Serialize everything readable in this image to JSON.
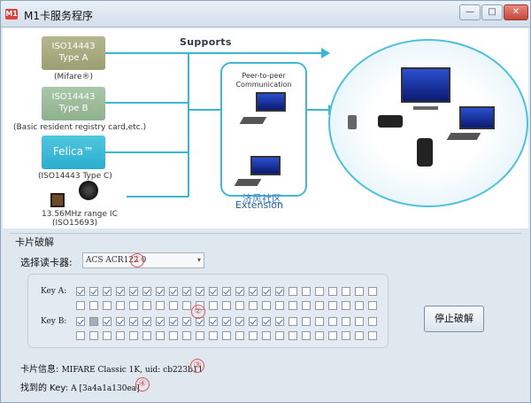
{
  "window": {
    "title": "M1卡服务程序",
    "logo_text": "M1",
    "min_glyph": "—",
    "max_glyph": "□",
    "close_glyph": "✕"
  },
  "banner": {
    "supports": "Supports",
    "card_a_line1": "ISO14443",
    "card_a_line2": "Type A",
    "card_a_caption": "(Mifare®)",
    "card_b_line1": "ISO14443",
    "card_b_line2": "Type B",
    "card_b_caption": "(Basic resident registry card,etc.)",
    "card_felica": "Felica™",
    "card_felica_caption": "(ISO14443 Type C)",
    "ic_caption_line1": "13.56MHz range IC",
    "ic_caption_line2": "(ISO15693)",
    "p2p_line1": "Peer-to-peer",
    "p2p_line2": "Communication",
    "extension": "Extension",
    "watermark": "济风社区"
  },
  "group": {
    "title": "卡片破解",
    "reader_label": "选择读卡器:",
    "reader_value": "ACS ACR122 0",
    "marker_1": "①",
    "marker_2": "②",
    "marker_3": "③",
    "marker_4": "④",
    "key_a_label": "Key A:",
    "key_b_label": "Key B:",
    "stop_button": "停止破解",
    "card_info_label": "卡片信息:",
    "card_info_value": "MIFARE Classic 1K, uid: cb223b11",
    "found_key_label": "找到的 Key:",
    "found_key_value": "A [3a4a1a130ea]"
  },
  "key_a_row1": [
    true,
    true,
    true,
    true,
    true,
    true,
    true,
    true,
    true,
    true,
    true,
    true,
    true,
    true,
    true,
    true,
    false,
    false,
    false,
    false,
    false,
    false,
    false
  ],
  "key_a_row2": [
    false,
    false,
    false,
    false,
    false,
    false,
    false,
    false,
    false,
    false,
    false,
    false,
    false,
    false,
    false,
    false,
    false,
    false,
    false,
    false,
    false,
    false,
    false
  ],
  "key_b_row1": [
    true,
    false,
    true,
    true,
    true,
    true,
    true,
    true,
    true,
    true,
    true,
    true,
    true,
    true,
    true,
    true,
    false,
    false,
    false,
    false,
    false,
    false,
    false
  ],
  "key_b_row2": [
    false,
    false,
    false,
    false,
    false,
    false,
    false,
    false,
    false,
    false,
    false,
    false,
    false,
    false,
    false,
    false,
    false,
    false,
    false,
    false,
    false,
    false,
    false
  ],
  "key_b_gray_index": 1
}
